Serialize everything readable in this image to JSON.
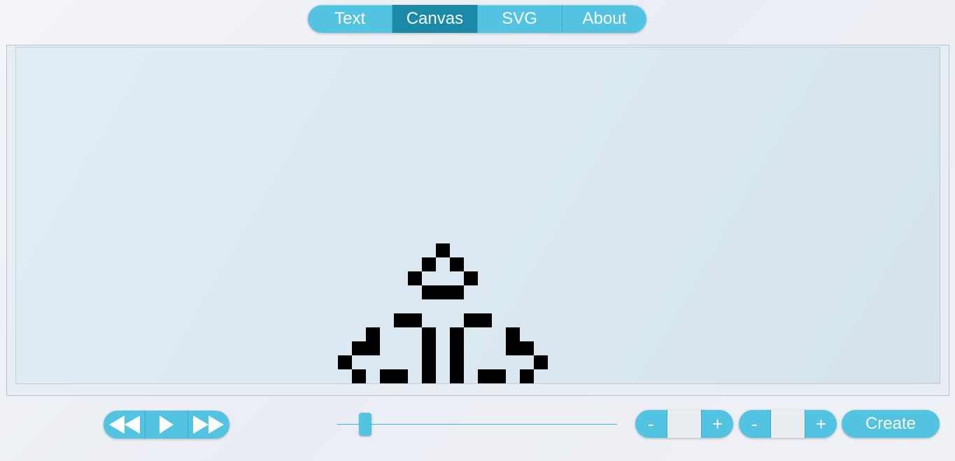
{
  "tabs": [
    {
      "label": "Text",
      "active": false
    },
    {
      "label": "Canvas",
      "active": true
    },
    {
      "label": "SVG",
      "active": false
    },
    {
      "label": "About",
      "active": false
    }
  ],
  "colors": {
    "accent": "#52c3e0",
    "accent_active": "#1b8aa8",
    "cell": "#000000",
    "board": "#dce9f2"
  },
  "board": {
    "live_cells": [
      [
        30,
        14
      ],
      [
        29,
        15
      ],
      [
        31,
        15
      ],
      [
        28,
        16
      ],
      [
        32,
        16
      ],
      [
        29,
        17
      ],
      [
        30,
        17
      ],
      [
        31,
        17
      ],
      [
        27,
        19
      ],
      [
        28,
        19
      ],
      [
        32,
        19
      ],
      [
        33,
        19
      ],
      [
        25,
        20
      ],
      [
        29,
        20
      ],
      [
        31,
        20
      ],
      [
        35,
        20
      ],
      [
        24,
        21
      ],
      [
        25,
        21
      ],
      [
        29,
        21
      ],
      [
        31,
        21
      ],
      [
        35,
        21
      ],
      [
        36,
        21
      ],
      [
        23,
        22
      ],
      [
        29,
        22
      ],
      [
        31,
        22
      ],
      [
        37,
        22
      ],
      [
        24,
        23
      ],
      [
        26,
        23
      ],
      [
        27,
        23
      ],
      [
        29,
        23
      ],
      [
        31,
        23
      ],
      [
        33,
        23
      ],
      [
        34,
        23
      ],
      [
        36,
        23
      ]
    ]
  },
  "controls": {
    "playback": {
      "rewind_icon": "rewind-icon",
      "play_icon": "play-icon",
      "fast_forward_icon": "fast-forward-icon"
    },
    "speed_slider": {
      "value": 0.1
    },
    "width_stepper": {
      "minus": "-",
      "plus": "+",
      "value": ""
    },
    "height_stepper": {
      "minus": "-",
      "plus": "+",
      "value": ""
    },
    "create_label": "Create"
  }
}
